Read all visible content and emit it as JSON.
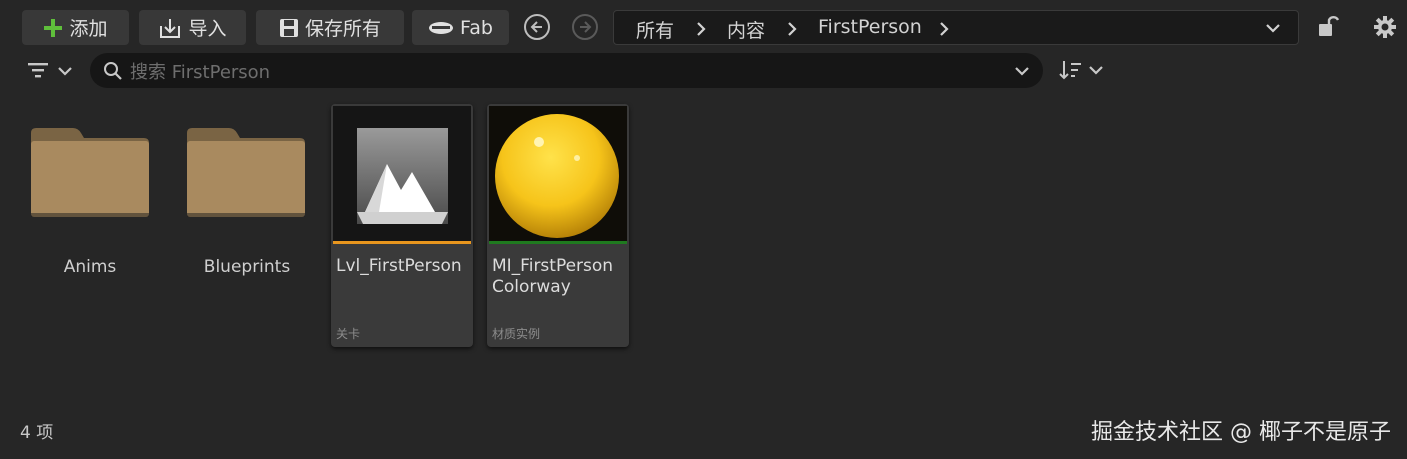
{
  "toolbar": {
    "add_label": "添加",
    "import_label": "导入",
    "save_all_label": "保存所有",
    "fab_label": "Fab",
    "icons": [
      "plus-icon",
      "import-icon",
      "save-icon",
      "fab-icon",
      "back-arrow-icon",
      "forward-arrow-icon",
      "lock-icon",
      "settings-gear-icon"
    ],
    "accent_green": "#5fbf3b"
  },
  "breadcrumb": {
    "items": [
      "所有",
      "内容",
      "FirstPerson"
    ]
  },
  "search": {
    "placeholder": "搜索 FirstPerson"
  },
  "assets": [
    {
      "kind": "folder",
      "name": "Anims"
    },
    {
      "kind": "folder",
      "name": "Blueprints"
    },
    {
      "kind": "asset",
      "name": "Lvl_FirstPerson",
      "type": "关卡",
      "accent": "#e8961e",
      "icon": "level-mountain-icon"
    },
    {
      "kind": "asset",
      "name_line1": "MI_FirstPerson",
      "name_line2": "Colorway",
      "type": "材质实例",
      "accent": "#1f7a1f",
      "icon": "material-sphere-icon"
    }
  ],
  "status": {
    "item_count": "4 项"
  },
  "watermark": "掘金技术社区 @ 椰子不是原子"
}
